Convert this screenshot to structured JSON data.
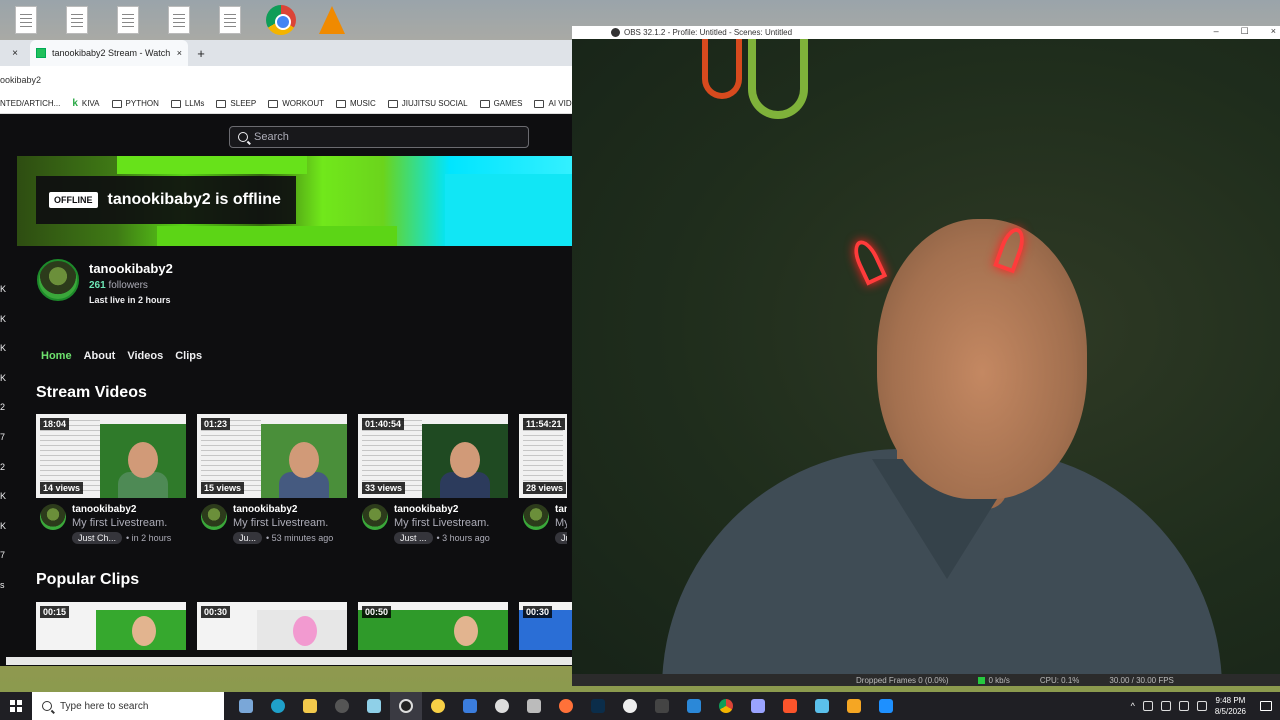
{
  "browser": {
    "tab_close_left": "×",
    "tab_title": "tanookibaby2 Stream - Watch L",
    "tab_close": "×",
    "new_tab": "+",
    "url": "ookibaby2",
    "bookmarks": [
      "NTED/ARTICH...",
      "KIVA",
      "PYTHON",
      "LLMs",
      "SLEEP",
      "WORKOUT",
      "MUSIC",
      "JIUJITSU SOCIAL",
      "GAMES",
      "AI VIDEO"
    ]
  },
  "twitch": {
    "search_placeholder": "Search",
    "offline_badge": "OFFLINE",
    "offline_text": "tanookibaby2 is offline",
    "channel_name": "tanookibaby2",
    "followers_count": "261",
    "followers_label": "followers",
    "last_live": "Last live in 2 hours",
    "tabs": [
      "Home",
      "About",
      "Videos",
      "Clips"
    ],
    "left_rail": [
      "K",
      "K",
      "K",
      "K",
      "2",
      "7",
      "2",
      "K",
      "K",
      "7",
      "s"
    ],
    "stream_videos_title": "Stream Videos",
    "videos": [
      {
        "duration": "18:04",
        "views": "14 views",
        "channel": "tanookibaby2",
        "title": "My first Livestream.",
        "tag": "Just Ch...",
        "ago": "• in 2 hours"
      },
      {
        "duration": "01:23",
        "views": "15 views",
        "channel": "tanookibaby2",
        "title": "My first Livestream.",
        "tag": "Ju...",
        "ago": "• 53 minutes ago"
      },
      {
        "duration": "01:40:54",
        "views": "33 views",
        "channel": "tanookibaby2",
        "title": "My first Livestream.",
        "tag": "Just ...",
        "ago": "• 3 hours ago"
      },
      {
        "duration": "11:54:21",
        "views": "28 views",
        "channel": "tan",
        "title": "My",
        "tag": "Ju",
        "ago": ""
      }
    ],
    "popular_clips_title": "Popular Clips",
    "clips": [
      {
        "duration": "00:15"
      },
      {
        "duration": "00:30"
      },
      {
        "duration": "00:50"
      },
      {
        "duration": "00:30"
      }
    ]
  },
  "obs": {
    "title": "OBS 32.1.2 - Profile: Untitled - Scenes: Untitled",
    "minimize": "–",
    "maximize": "☐",
    "close": "×",
    "status_dropped": "Dropped Frames 0 (0.0%)",
    "status_kbps": "0 kb/s",
    "status_cpu": "CPU: 0.1%",
    "status_fps": "30.00 / 30.00 FPS"
  },
  "taskbar": {
    "search_placeholder": "Type here to search",
    "time": "9:48 PM",
    "date": "8/5/2026"
  },
  "colors": {
    "twitch_bg": "#0e0e10",
    "accent_green": "#6ee36e",
    "offline_card": "#0e0e10"
  }
}
